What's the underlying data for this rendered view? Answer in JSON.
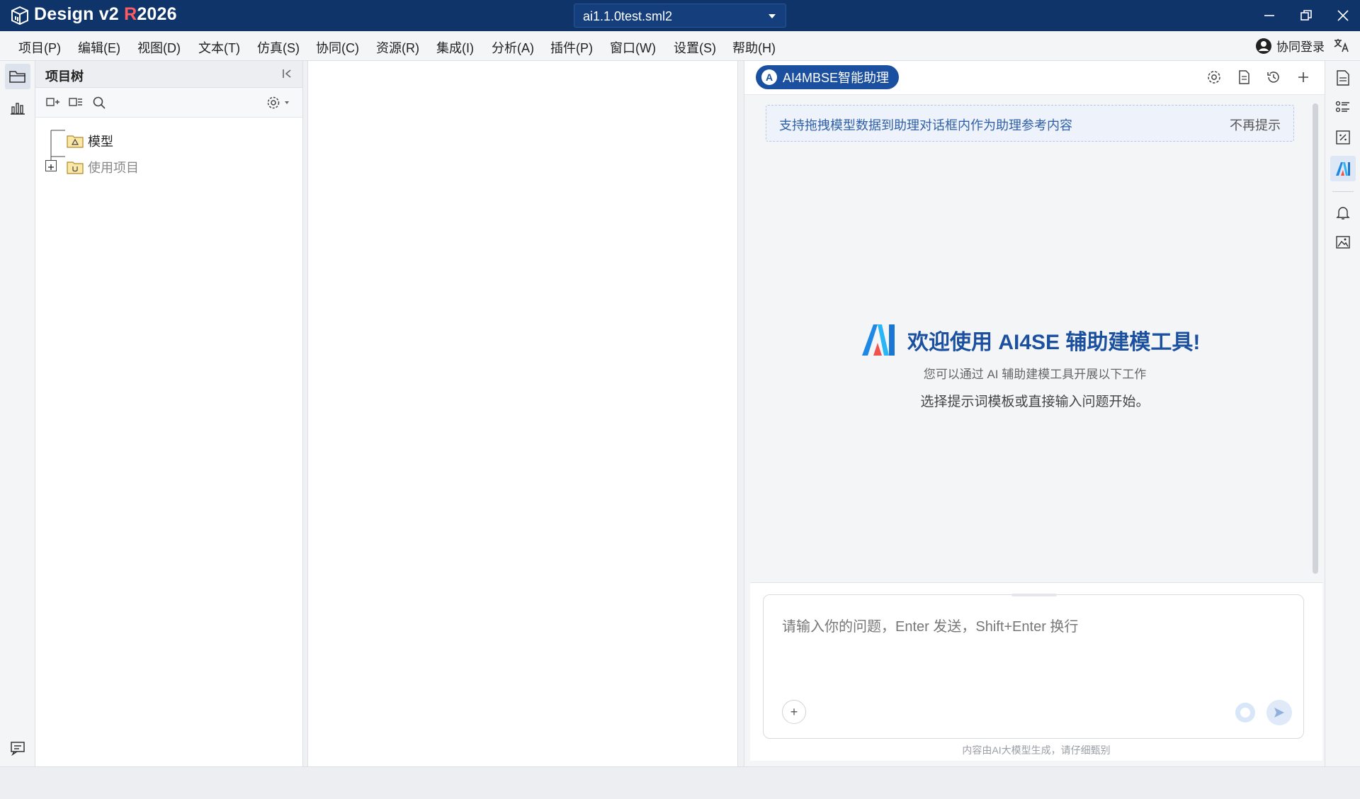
{
  "app": {
    "name_prefix": "Design v2 ",
    "name_brand_letter": "R",
    "name_suffix": "2026"
  },
  "file": {
    "current": "ai1.1.0test.sml2"
  },
  "menu": [
    "项目(P)",
    "编辑(E)",
    "视图(D)",
    "文本(T)",
    "仿真(S)",
    "协同(C)",
    "资源(R)",
    "集成(I)",
    "分析(A)",
    "插件(P)",
    "窗口(W)",
    "设置(S)",
    "帮助(H)"
  ],
  "login": {
    "label": "协同登录"
  },
  "tree": {
    "title": "项目树",
    "nodes": [
      {
        "label": "模型",
        "muted": false
      },
      {
        "label": "使用项目",
        "muted": true
      }
    ]
  },
  "ai": {
    "badge_letter": "A",
    "badge_label": "AI4MBSE智能助理",
    "tip": "支持拖拽模型数据到助理对话框内作为助理参考内容",
    "tip_dismiss": "不再提示",
    "welcome_title": "欢迎使用 AI4SE 辅助建模工具!",
    "welcome_sub": "您可以通过 AI 辅助建模工具开展以下工作",
    "welcome_sub2": "选择提示词模板或直接输入问题开始。",
    "input_placeholder": "请输入你的问题，Enter 发送，Shift+Enter 换行",
    "plus": "+",
    "disclaimer": "内容由AI大模型生成，请仔细甄别"
  },
  "colors": {
    "titlebar": "#0f3469",
    "accent": "#1b4f9f",
    "brand_red": "#ff5a64"
  }
}
